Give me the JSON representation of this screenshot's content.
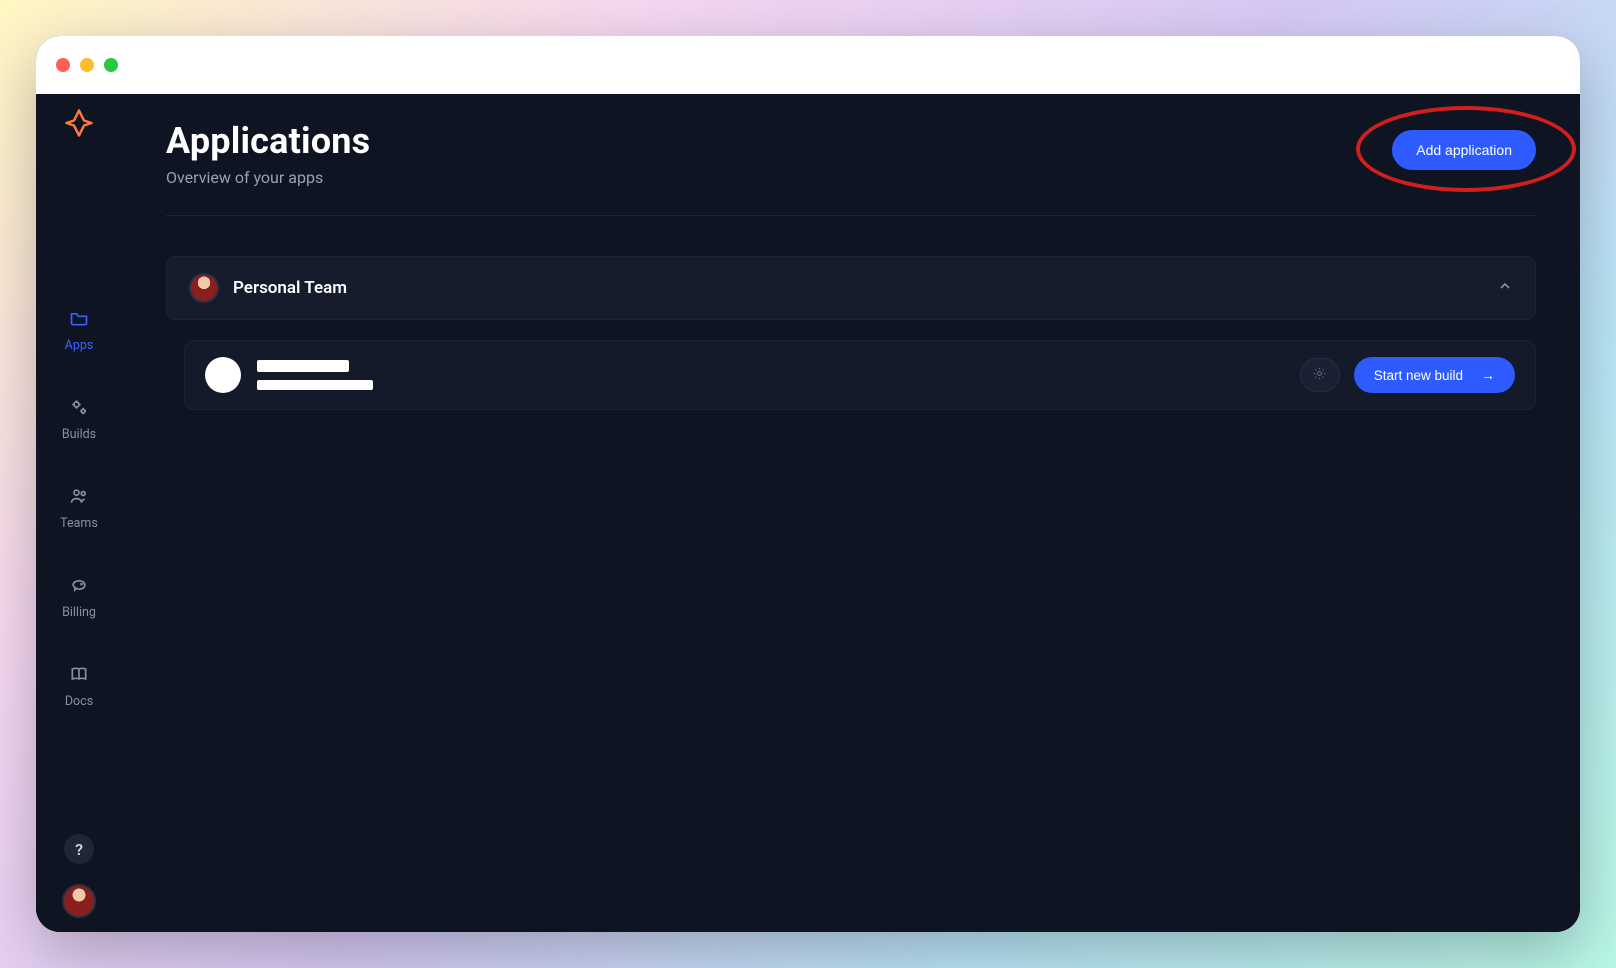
{
  "header": {
    "title": "Applications",
    "subtitle": "Overview of your apps",
    "add_label": "Add application"
  },
  "sidebar": {
    "items": [
      {
        "label": "Apps"
      },
      {
        "label": "Builds"
      },
      {
        "label": "Teams"
      },
      {
        "label": "Billing"
      },
      {
        "label": "Docs"
      }
    ],
    "help_label": "?"
  },
  "team": {
    "name": "Personal Team"
  },
  "app_row": {
    "start_label": "Start new build"
  },
  "colors": {
    "accent": "#2d5bff",
    "callout": "#d21e1e"
  }
}
